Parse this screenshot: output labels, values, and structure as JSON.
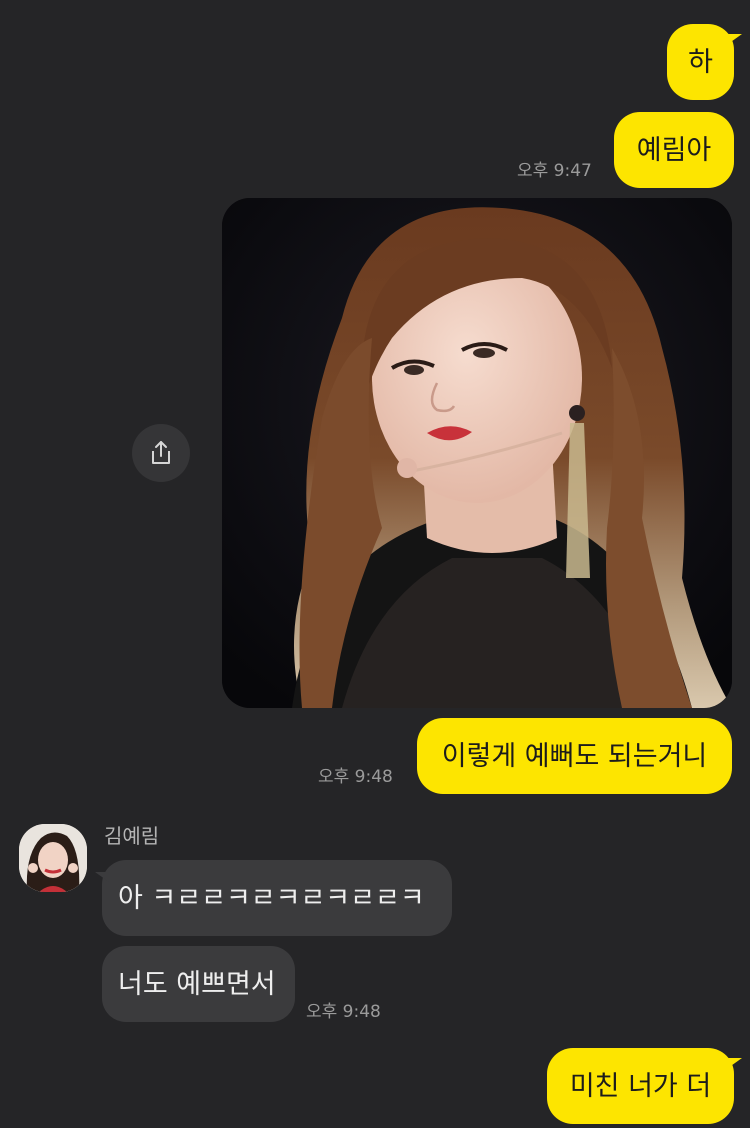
{
  "colors": {
    "background": "#252527",
    "my_bubble": "#fde500",
    "their_bubble": "#3b3b3d",
    "timestamp": "#9b9b9b"
  },
  "messages": {
    "m1": {
      "text": "하"
    },
    "m2": {
      "text": "예림아",
      "time": "오후 9:47"
    },
    "m3": {
      "image": "photo of a woman with long wavy hair and dangling earrings on stage"
    },
    "m4": {
      "text": "이렇게 예뻐도 되는거니",
      "time": "오후 9:48"
    },
    "m5": {
      "text": "아 ㅋㄹㄹㅋㄹㅋㄹㅋㄹㄹㅋ"
    },
    "m6": {
      "text": "너도 예쁘면서",
      "time": "오후 9:48"
    },
    "m7": {
      "text": "미친 너가 더"
    }
  },
  "contact": {
    "name": "김예림"
  },
  "icons": {
    "share": "share-icon"
  }
}
